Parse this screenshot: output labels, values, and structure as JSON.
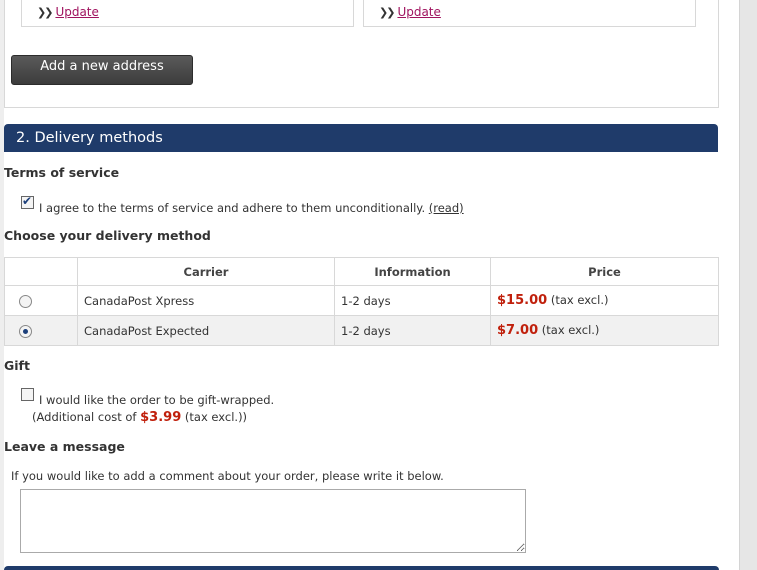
{
  "address": {
    "update_label_1": "Update",
    "update_label_2": "Update",
    "add_new_label": "Add a new address"
  },
  "step": {
    "title": "2. Delivery methods"
  },
  "terms": {
    "heading": "Terms of service",
    "agree_text": "I agree to the terms of service and adhere to them unconditionally.",
    "read_link": "(read)",
    "checked": true
  },
  "delivery": {
    "heading": "Choose your delivery method",
    "columns": [
      "Carrier",
      "Information",
      "Price"
    ],
    "rows": [
      {
        "carrier": "CanadaPost Xpress",
        "info": "1-2 days",
        "price": "$15.00",
        "tax": "(tax excl.)",
        "selected": false
      },
      {
        "carrier": "CanadaPost Expected",
        "info": "1-2 days",
        "price": "$7.00",
        "tax": "(tax excl.)",
        "selected": true
      }
    ]
  },
  "gift": {
    "heading": "Gift",
    "wrap_text": "I would like the order to be gift-wrapped.",
    "cost_prefix": "(Additional cost of",
    "cost_value": "$3.99",
    "cost_suffix": "(tax excl.))",
    "checked": false
  },
  "message": {
    "heading": "Leave a message",
    "hint": "If you would like to add a comment about your order, please write it below.",
    "value": ""
  },
  "colors": {
    "header_blue": "#1f3b6a",
    "price_red": "#c0200c",
    "link_magenta": "#a0135f"
  }
}
